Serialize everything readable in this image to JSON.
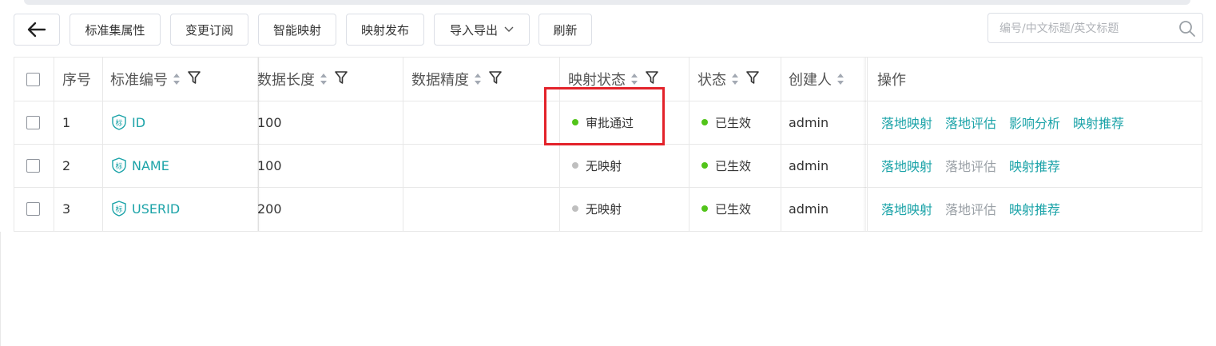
{
  "toolbar": {
    "back_icon": "arrow-left-icon",
    "buttons": [
      "标准集属性",
      "变更订阅",
      "智能映射",
      "映射发布",
      "导入导出",
      "刷新"
    ],
    "dropdown_icon": "chevron-down-icon"
  },
  "search": {
    "placeholder": "编号/中文标题/英文标题",
    "value": "",
    "icon": "search-icon"
  },
  "table": {
    "headers": [
      "序号",
      "标准编号",
      "数据长度",
      "数据精度",
      "映射状态",
      "状态",
      "创建人",
      "操作"
    ],
    "rows": [
      {
        "index": "1",
        "code": "ID",
        "length": "100",
        "precision": "",
        "mapping": "审批通过",
        "mapping_color": "#52c41a",
        "status": "已生效",
        "status_color": "#52c41a",
        "creator": "admin",
        "actions": [
          "落地映射",
          "落地评估",
          "影响分析",
          "映射推荐"
        ],
        "disabled_actions": []
      },
      {
        "index": "2",
        "code": "NAME",
        "length": "100",
        "precision": "",
        "mapping": "无映射",
        "mapping_color": "#bfbfbf",
        "status": "已生效",
        "status_color": "#52c41a",
        "creator": "admin",
        "actions": [
          "落地映射",
          "落地评估",
          "映射推荐"
        ],
        "disabled_actions": [
          "落地评估"
        ]
      },
      {
        "index": "3",
        "code": "USERID",
        "length": "200",
        "precision": "",
        "mapping": "无映射",
        "mapping_color": "#bfbfbf",
        "status": "已生效",
        "status_color": "#52c41a",
        "creator": "admin",
        "actions": [
          "落地映射",
          "落地评估",
          "映射推荐"
        ],
        "disabled_actions": [
          "落地评估"
        ]
      }
    ],
    "code_badge_text": "标"
  },
  "colors": {
    "link": "#1ba3a8",
    "highlight": "#e3222a",
    "success": "#52c41a",
    "inactive": "#bfbfbf"
  }
}
